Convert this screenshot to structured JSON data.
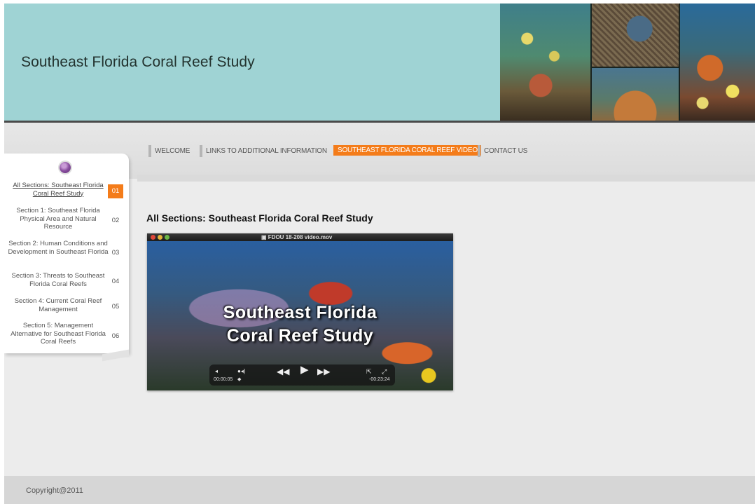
{
  "header": {
    "title": "Southeast Florida Coral Reef Study"
  },
  "nav": {
    "items": [
      {
        "label": "WELCOME"
      },
      {
        "label": "LINKS TO ADDITIONAL INFORMATION"
      },
      {
        "label": "SOUTHEAST FLORIDA CORAL REEF VIDEO"
      },
      {
        "label": "CONTACT US"
      }
    ],
    "active_index": 2,
    "active_color": "#f47c1a"
  },
  "sidebar": {
    "items": [
      {
        "label": "All Sections: Southeast Florida Coral Reef Study",
        "number": "01"
      },
      {
        "label": "Section 1: Southeast Florida Physical Area and Natural Resource",
        "number": "02"
      },
      {
        "label": "Section 2: Human Conditions and Development in Southeast Florida",
        "number": "03"
      },
      {
        "label": "Section 3: Threats to Southeast Florida Coral Reefs",
        "number": "04"
      },
      {
        "label": "Section 4: Current Coral Reef Management",
        "number": "05"
      },
      {
        "label": "Section 5: Management Alternative for Southeast Florida Coral Reefs",
        "number": "06"
      }
    ],
    "active_index": 0
  },
  "main": {
    "section_title": "All Sections: Southeast Florida Coral Reef Study",
    "video": {
      "filename": "FDOU 18-208 video.mov",
      "title_line1": "Southeast Florida",
      "title_line2": "Coral Reef Study",
      "elapsed": "00:00:05",
      "remaining": "-00:23:24"
    }
  },
  "footer": {
    "copyright": "Copyright@2011"
  }
}
